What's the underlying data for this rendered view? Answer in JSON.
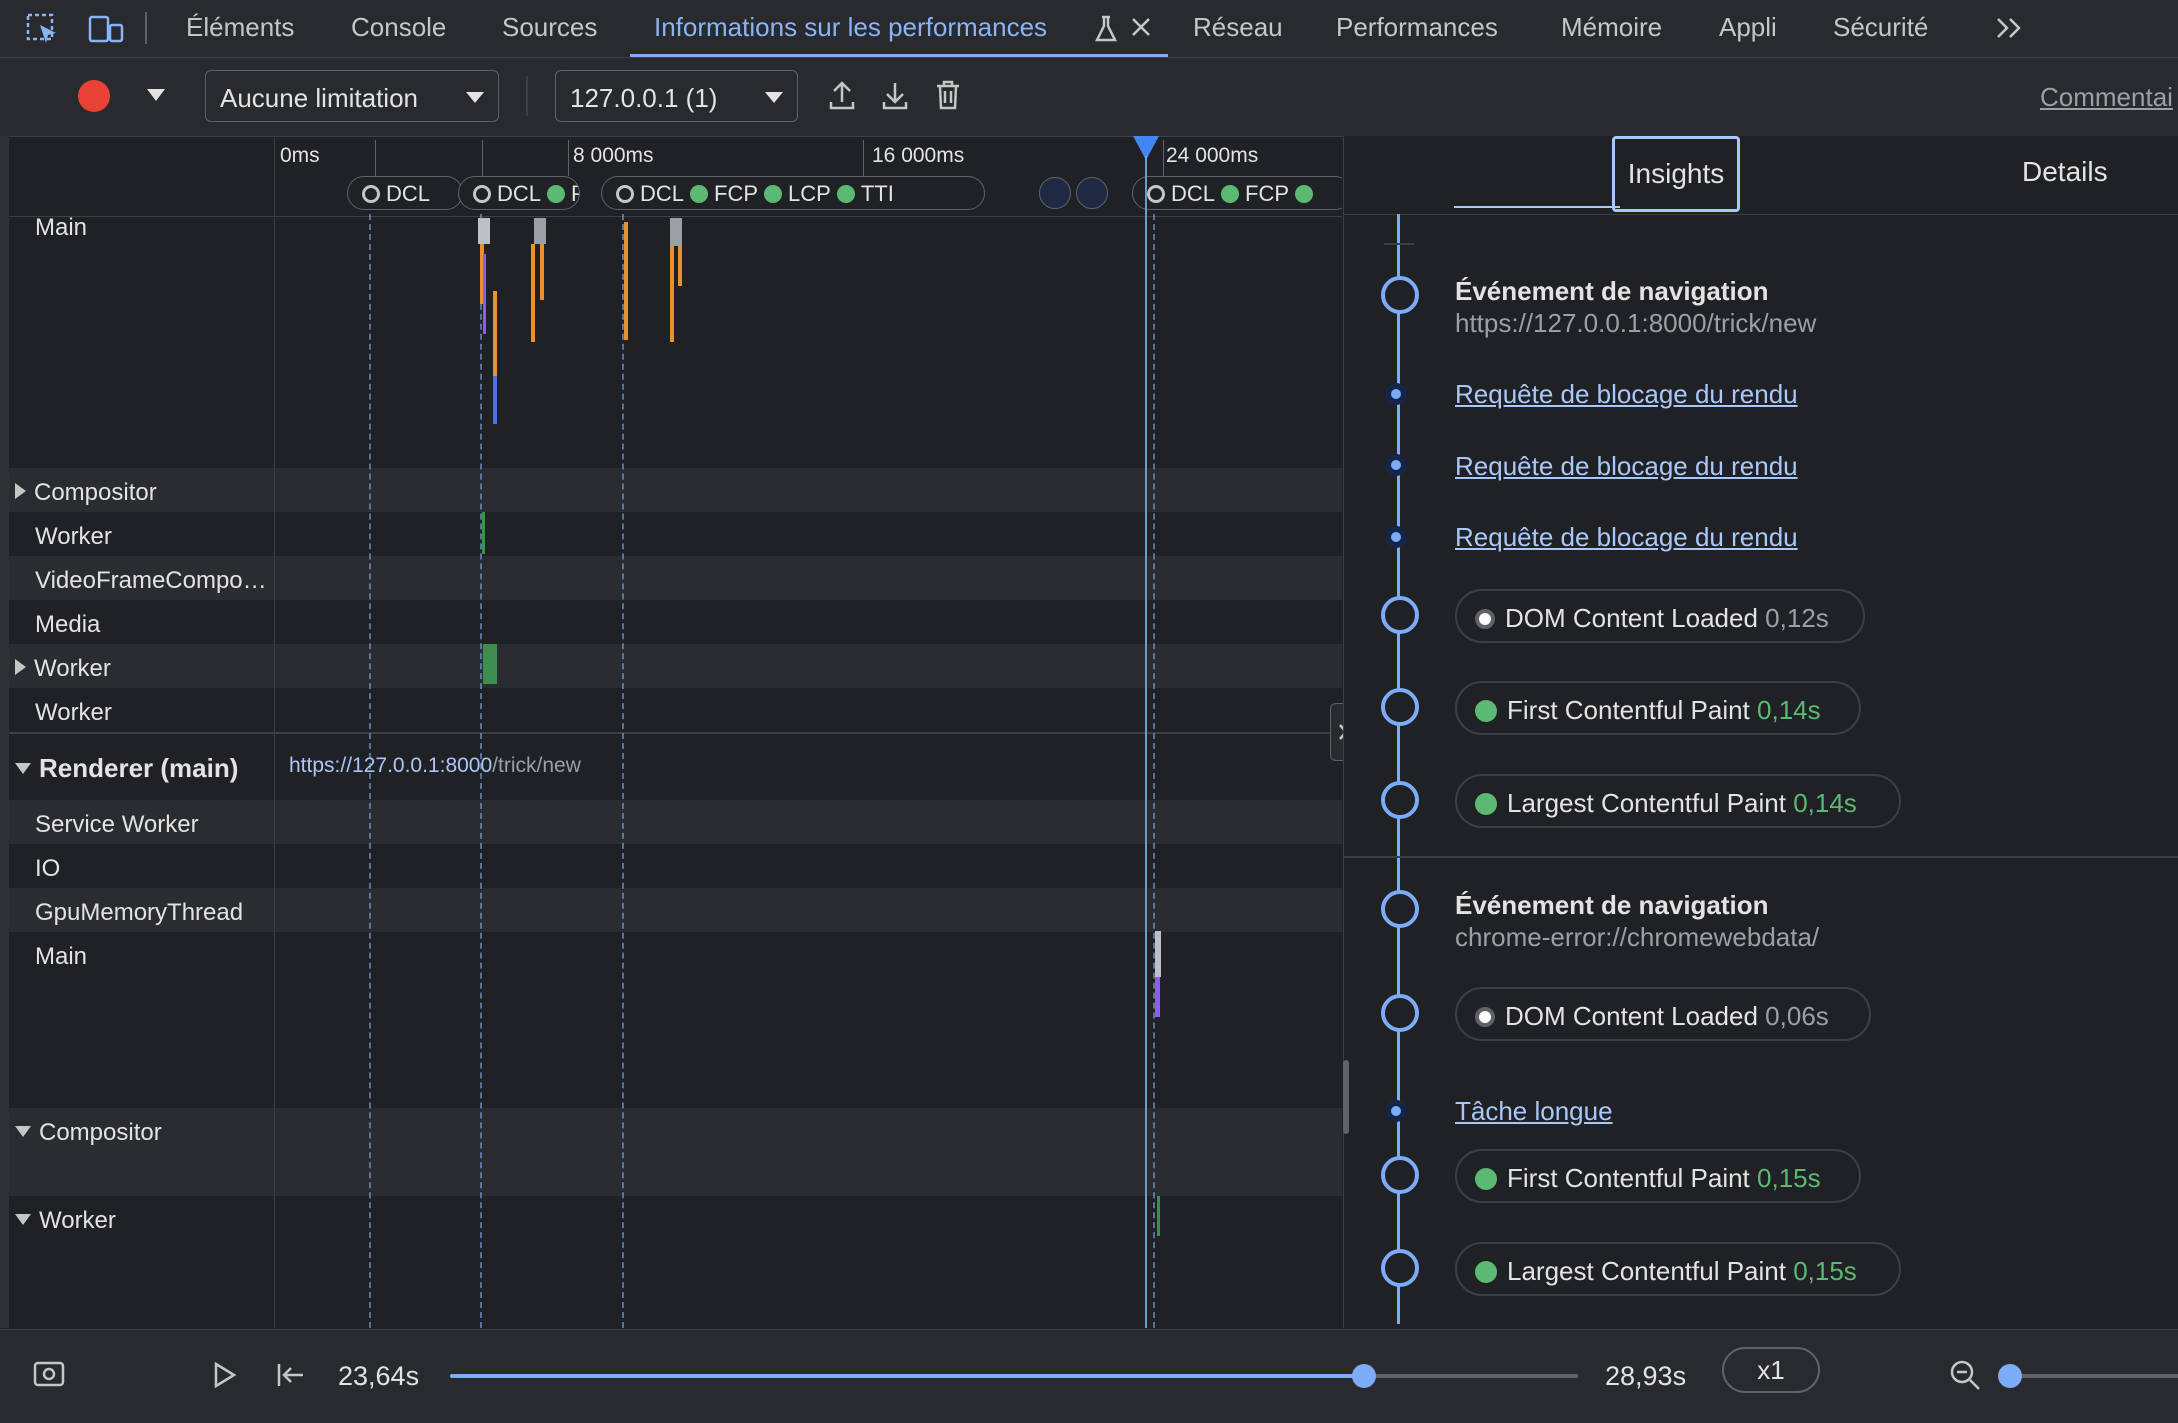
{
  "tabs": {
    "elements": "Éléments",
    "console": "Console",
    "sources": "Sources",
    "perf_insights": "Informations sur les performances",
    "network": "Réseau",
    "performance": "Performances",
    "memory": "Mémoire",
    "app": "Appli",
    "security": "Sécurité"
  },
  "toolbar": {
    "throttling": "Aucune limitation",
    "target": "127.0.0.1 (1)",
    "comment": "Commentai"
  },
  "ruler": {
    "t0": "0ms",
    "t1": "8 000ms",
    "t2": "16 000ms",
    "t3": "24 000ms"
  },
  "markers": {
    "dcl": "DCL",
    "fcp": "FCP",
    "lcp": "LCP",
    "tti": "TTI",
    "p": "P"
  },
  "tracks": {
    "main_top": "Main",
    "compositor1": "Compositor",
    "worker1": "Worker",
    "videoframe": "VideoFrameCompo…",
    "media": "Media",
    "worker2": "Worker",
    "worker3": "Worker",
    "renderer": "Renderer (main)",
    "renderer_url_host": "https://127.0.0.1:8000",
    "renderer_url_path": "/trick/new",
    "service_worker": "Service Worker",
    "io": "IO",
    "gpu": "GpuMemoryThread",
    "main_bottom": "Main",
    "compositor2": "Compositor",
    "worker4": "Worker"
  },
  "sidebar": {
    "tab_insights": "Insights",
    "tab_details": "Details",
    "nav1_title": "Événement de navigation",
    "nav1_url": "https://127.0.0.1:8000/trick/new",
    "render_block_1": "Requête de blocage du rendu",
    "render_block_2": "Requête de blocage du rendu",
    "render_block_3": "Requête de blocage du rendu",
    "nav1_dcl_label": "DOM Content Loaded",
    "nav1_dcl_value": "0,12s",
    "nav1_fcp_label": "First Contentful Paint",
    "nav1_fcp_value": "0,14s",
    "nav1_lcp_label": "Largest Contentful Paint",
    "nav1_lcp_value": "0,14s",
    "nav2_title": "Événement de navigation",
    "nav2_url": "chrome-error://chromewebdata/",
    "nav2_dcl_label": "DOM Content Loaded",
    "nav2_dcl_value": "0,06s",
    "long_task": "Tâche longue",
    "nav2_fcp_label": "First Contentful Paint",
    "nav2_fcp_value": "0,15s",
    "nav2_lcp_label": "Largest Contentful Paint",
    "nav2_lcp_value": "0,15s"
  },
  "bottom": {
    "start_time": "23,64s",
    "end_time": "28,93s",
    "speed": "x1",
    "playhead_fraction": 0.81
  },
  "colors": {
    "accent": "#8ab4f8",
    "record": "#e94235",
    "fcp_green": "#5bb974",
    "script_orange": "#e8912d",
    "render_purple": "#8b5cf6"
  }
}
